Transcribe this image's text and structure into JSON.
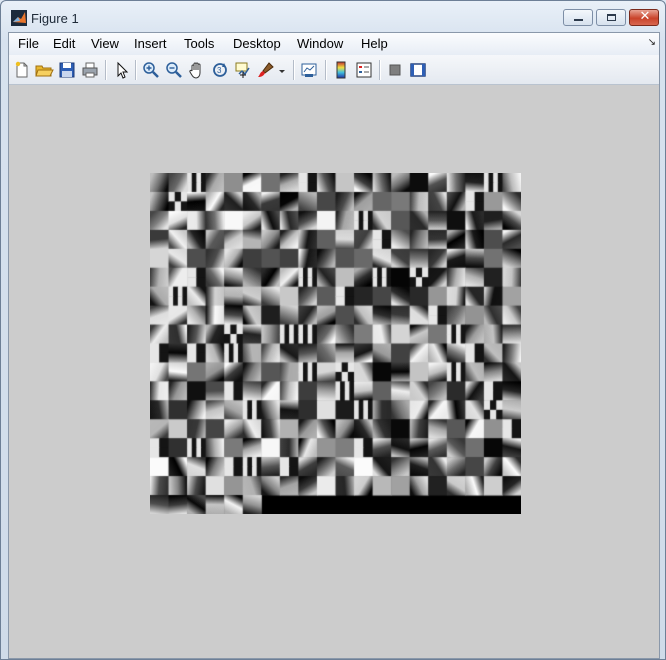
{
  "window": {
    "title": "Figure 1",
    "controls": {
      "minimize": "minimize",
      "maximize": "maximize",
      "close": "✕"
    }
  },
  "menubar": {
    "items": [
      "File",
      "Edit",
      "View",
      "Insert",
      "Tools",
      "Desktop",
      "Window",
      "Help"
    ]
  },
  "toolbar": {
    "buttons": [
      "new-figure-icon",
      "open-file-icon",
      "save-icon",
      "print-icon",
      "edit-plot-icon",
      "zoom-in-icon",
      "zoom-out-icon",
      "pan-icon",
      "rotate-3d-icon",
      "data-cursor-icon",
      "brush-icon",
      "link-plot-icon",
      "colorbar-icon",
      "legend-icon",
      "hide-plot-tools-icon",
      "show-plot-tools-icon"
    ]
  },
  "figure": {
    "image_description_grid": {
      "tiles_across": 20,
      "tiles_down": 18,
      "filled_tiles_last_row": 6
    },
    "colors": {
      "background": "#cccccc",
      "image_background": "#000000"
    }
  }
}
